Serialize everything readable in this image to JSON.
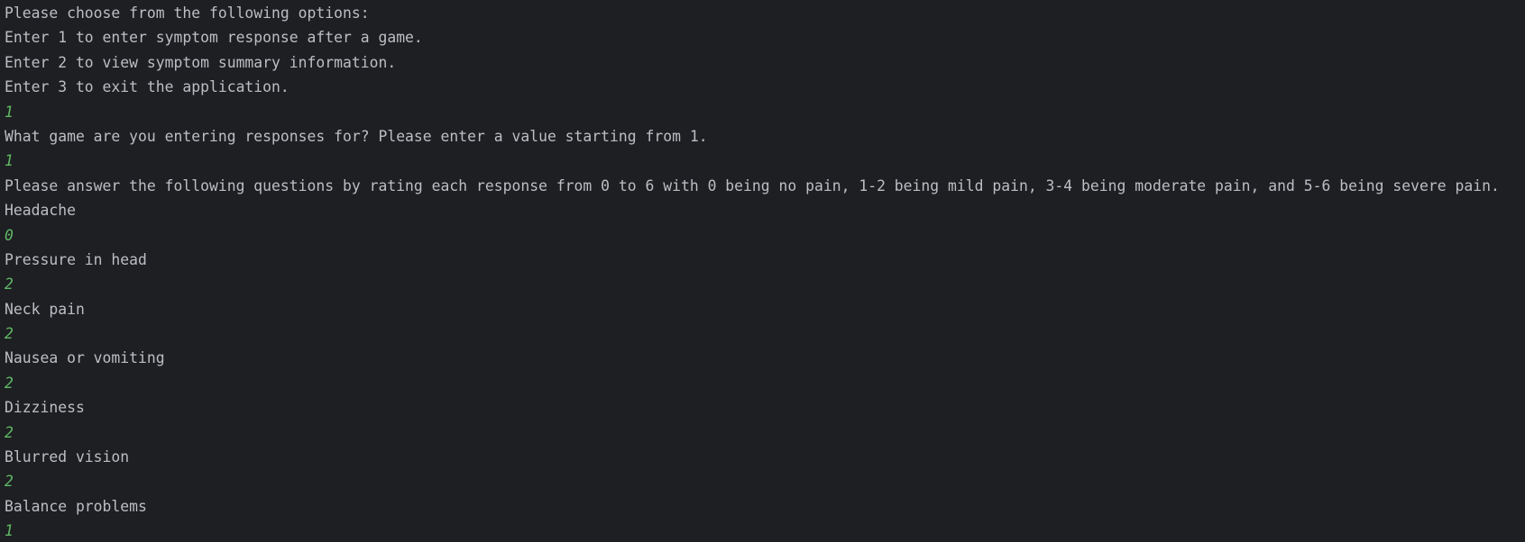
{
  "console": {
    "lines": [
      {
        "kind": "output",
        "text": "Please choose from the following options:"
      },
      {
        "kind": "output",
        "text": "Enter 1 to enter symptom response after a game."
      },
      {
        "kind": "output",
        "text": "Enter 2 to view symptom summary information."
      },
      {
        "kind": "output",
        "text": "Enter 3 to exit the application."
      },
      {
        "kind": "input",
        "text": "1"
      },
      {
        "kind": "output",
        "text": "What game are you entering responses for? Please enter a value starting from 1."
      },
      {
        "kind": "input",
        "text": "1"
      },
      {
        "kind": "output",
        "text": "Please answer the following questions by rating each response from 0 to 6 with 0 being no pain, 1-2 being mild pain, 3-4 being moderate pain, and 5-6 being severe pain."
      },
      {
        "kind": "output",
        "text": "Headache"
      },
      {
        "kind": "input",
        "text": "0"
      },
      {
        "kind": "output",
        "text": "Pressure in head"
      },
      {
        "kind": "input",
        "text": "2"
      },
      {
        "kind": "output",
        "text": "Neck pain"
      },
      {
        "kind": "input",
        "text": "2"
      },
      {
        "kind": "output",
        "text": "Nausea or vomiting"
      },
      {
        "kind": "input",
        "text": "2"
      },
      {
        "kind": "output",
        "text": "Dizziness"
      },
      {
        "kind": "input",
        "text": "2"
      },
      {
        "kind": "output",
        "text": "Blurred vision"
      },
      {
        "kind": "input",
        "text": "2"
      },
      {
        "kind": "output",
        "text": "Balance problems"
      },
      {
        "kind": "input",
        "text": "1"
      }
    ]
  },
  "colors": {
    "background": "#1e1f22",
    "output_text": "#bcbec4",
    "input_text": "#5fb865"
  }
}
